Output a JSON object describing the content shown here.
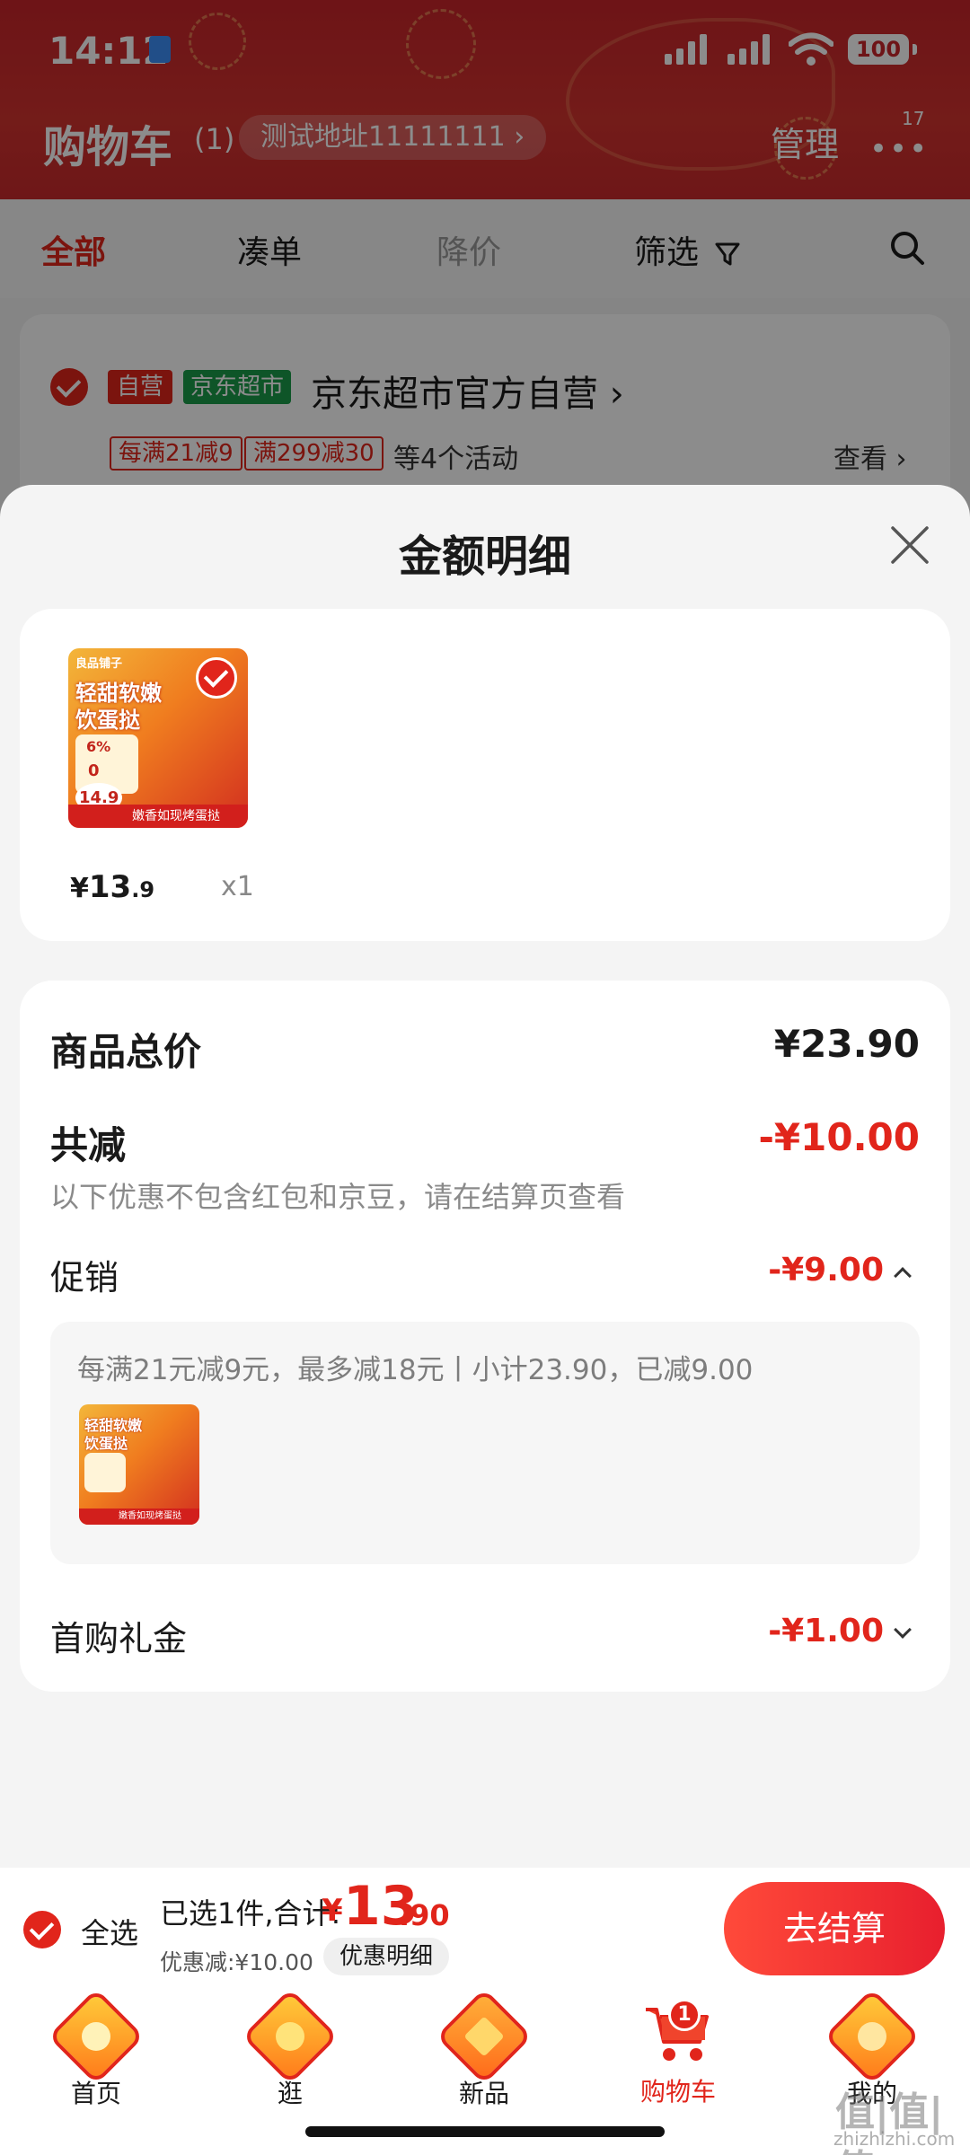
{
  "status_bar": {
    "time": "14:12",
    "battery": "100"
  },
  "header": {
    "title": "购物车",
    "count": "(1)",
    "address": "测试地址11111111 ›",
    "manage": "管理",
    "more": "•••",
    "more_badge": "17"
  },
  "tabs": [
    {
      "label": "全部",
      "state": "active"
    },
    {
      "label": "凑单",
      "state": "normal"
    },
    {
      "label": "降价",
      "state": "muted"
    },
    {
      "label": "筛选",
      "state": "normal"
    }
  ],
  "shop": {
    "tag_self": "自营",
    "tag_mart": "京东超市",
    "name": "京东超市官方自营 ›",
    "promo_chips": [
      "每满21减9",
      "满299减30"
    ],
    "promo_more": "等4个活动",
    "view": "查看 ›"
  },
  "sheet": {
    "title": "金额明细",
    "product": {
      "thumb_brand": "良品铺子",
      "thumb_headline_1": "轻甜软嫩",
      "thumb_headline_2": "饮蛋挞",
      "thumb_pct": "6%",
      "thumb_zero": "0",
      "thumb_price": "14.9",
      "thumb_banner": "嫩香如现烤蛋挞",
      "price_yen": "¥",
      "price_int": "13",
      "price_dec": ".9",
      "qty": "x1"
    },
    "summary": {
      "total_label": "商品总价",
      "total_value": "¥23.90",
      "reduce_label": "共减",
      "reduce_value": "-¥10.00",
      "note": "以下优惠不包含红包和京豆，请在结算页查看",
      "promo_label": "促销",
      "promo_value": "-¥9.00",
      "promo_detail": "每满21元减9元，最多减18元丨小计23.90，已减9.00",
      "gift_label": "首购礼金",
      "gift_value": "-¥1.00"
    }
  },
  "checkout": {
    "select_all": "全选",
    "summary": "已选1件,合计:",
    "total_yen": "¥",
    "total_int": "13",
    "total_dec": ".90",
    "discount": "优惠减:¥10.00",
    "detail_button": "优惠明细",
    "pay_button": "去结算"
  },
  "nav": [
    {
      "label": "首页",
      "icon": "home-icon"
    },
    {
      "label": "逛",
      "icon": "stroll-icon"
    },
    {
      "label": "新品",
      "icon": "new-products-icon"
    },
    {
      "label": "购物车",
      "icon": "cart-icon",
      "active": true,
      "badge": "1"
    },
    {
      "label": "我的",
      "icon": "profile-icon"
    }
  ],
  "watermark": {
    "main": "值|值|值",
    "sub": "zhizhizhi.com"
  },
  "colors": {
    "brand_red": "#e1251b",
    "header_red": "#c8252a",
    "mart_green": "#1a9b4a"
  }
}
